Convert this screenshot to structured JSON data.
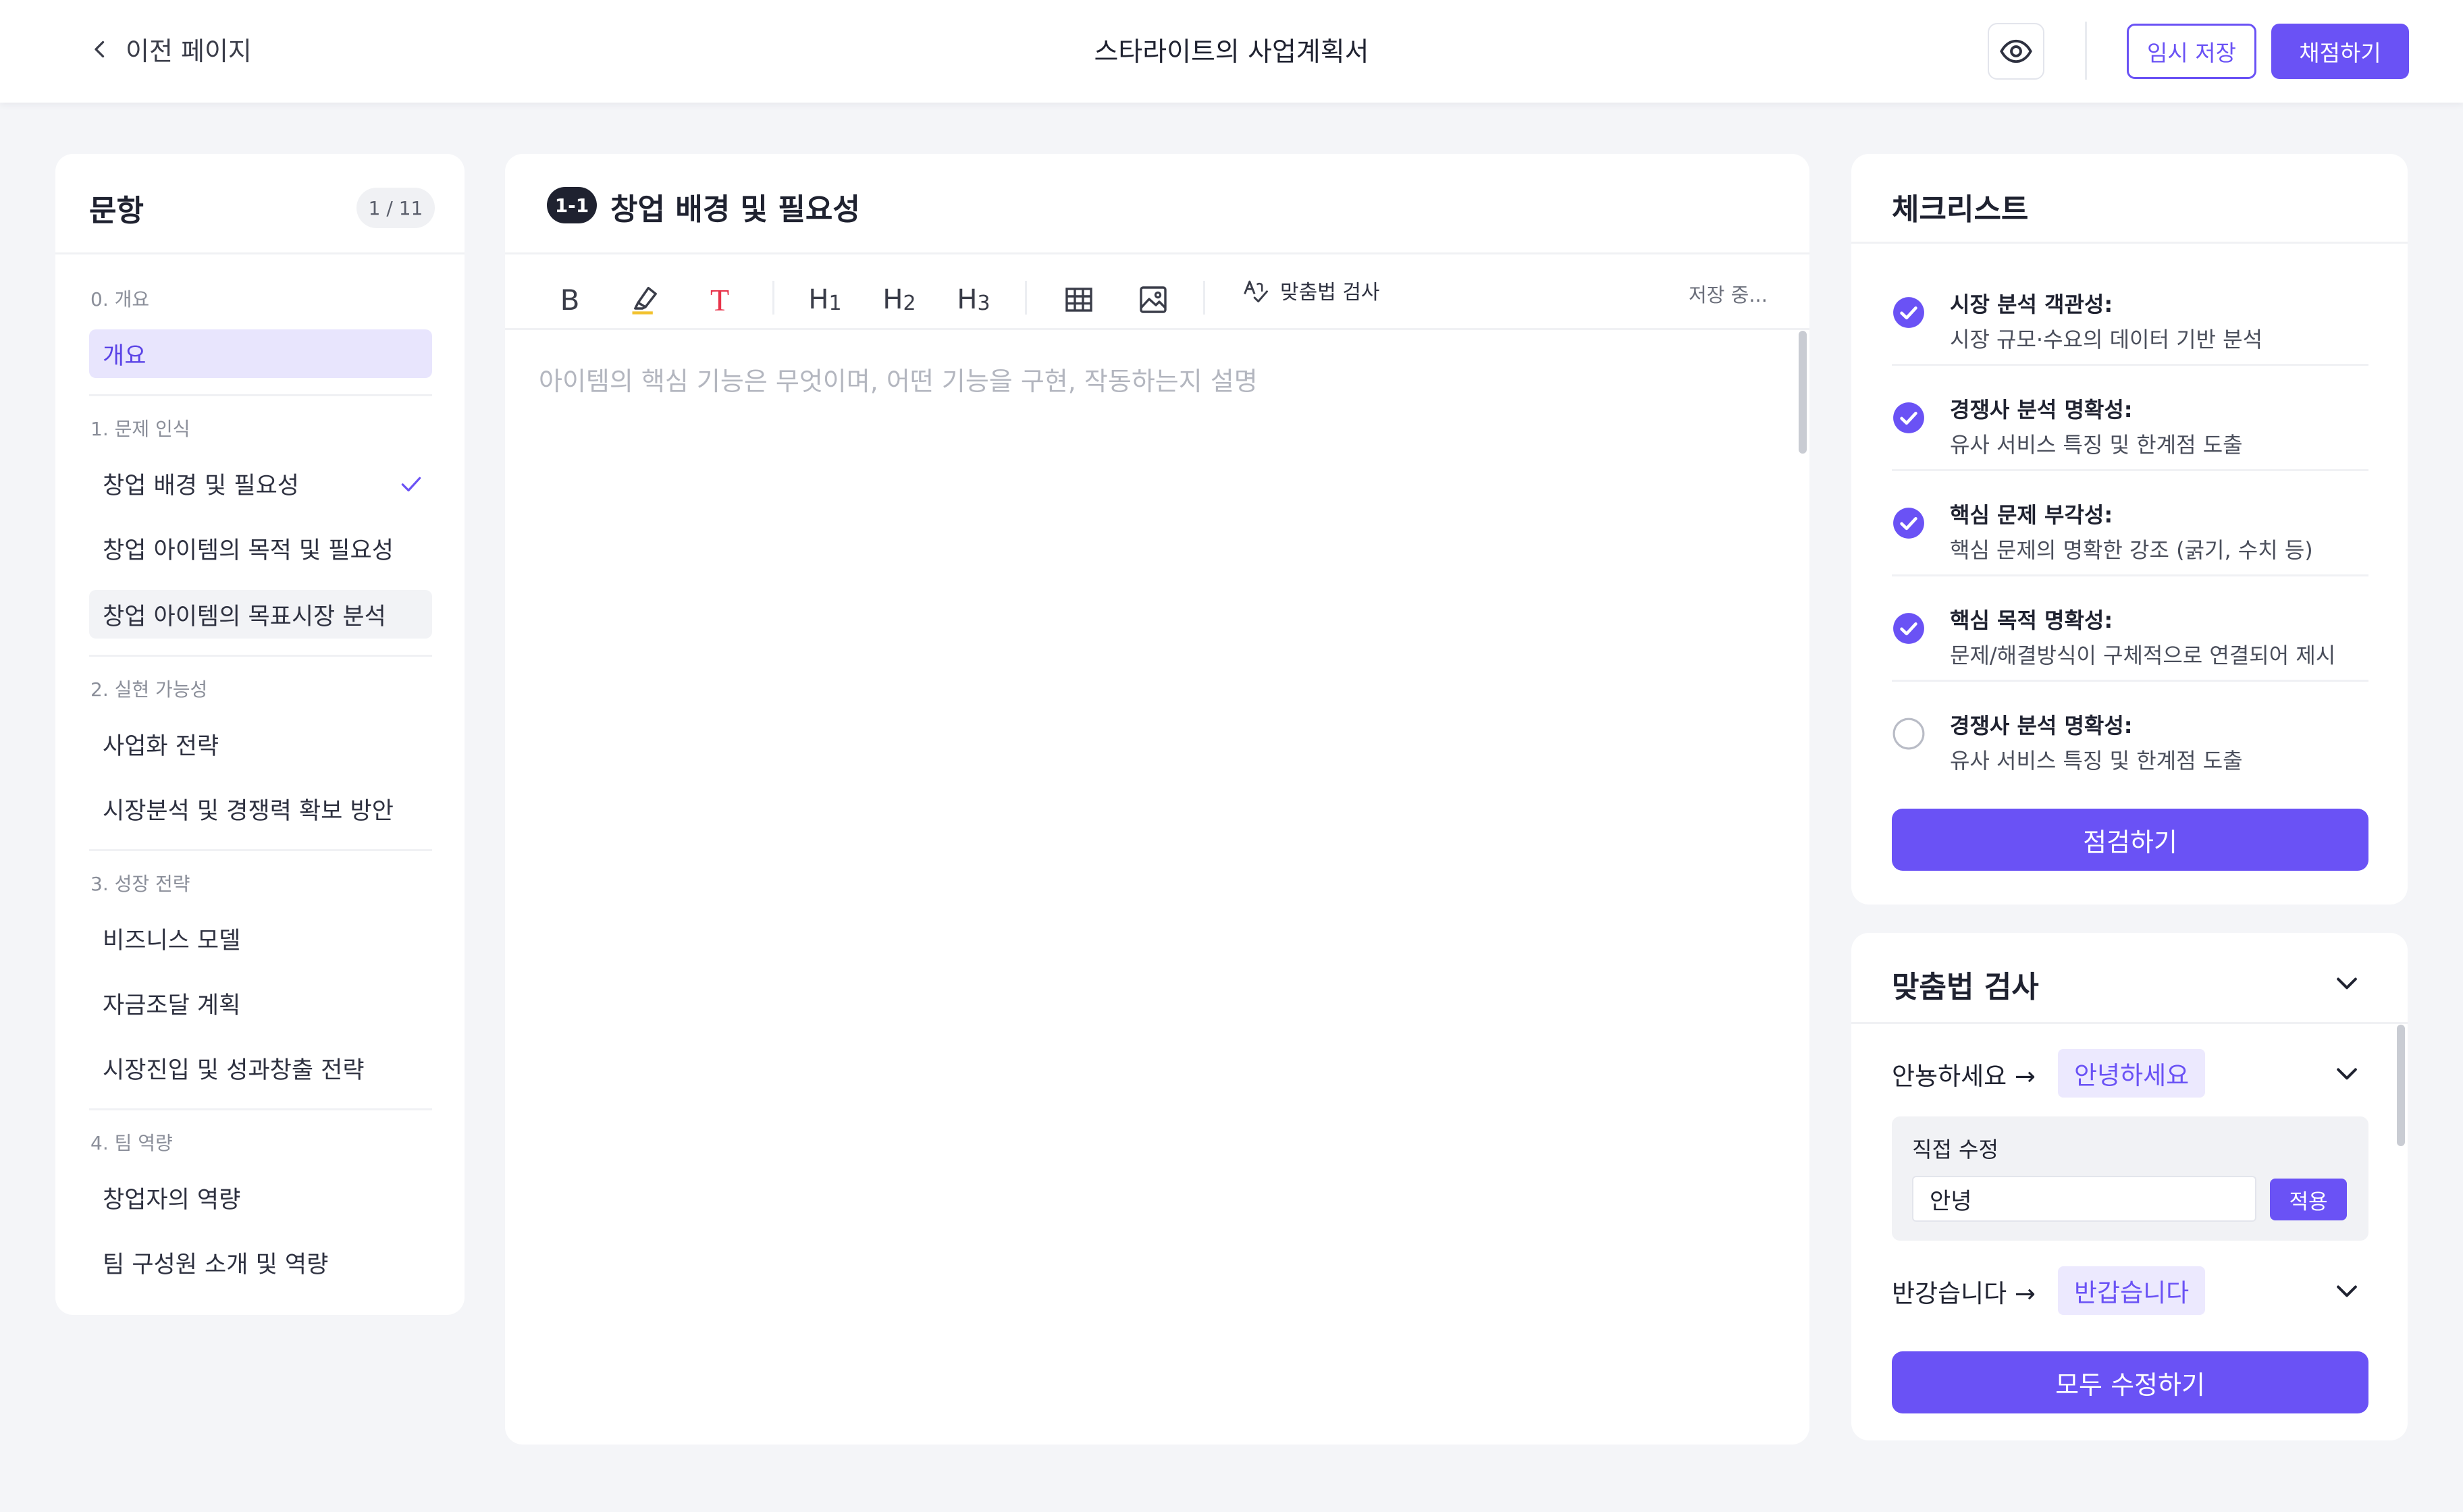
{
  "header": {
    "back_label": "이전 페이지",
    "doc_title": "스타라이트의 사업계획서",
    "temp_save_label": "임시 저장",
    "grade_label": "채점하기"
  },
  "questions": {
    "title": "문항",
    "count": "1 / 11",
    "sections": [
      {
        "label": "0. 개요",
        "items": [
          {
            "label": "개요"
          }
        ]
      },
      {
        "label": "1. 문제 인식",
        "items": [
          {
            "label": "창업 배경 및 필요성"
          },
          {
            "label": "창업 아이템의 목적 및 필요성"
          },
          {
            "label": "창업 아이템의 목표시장 분석"
          }
        ]
      },
      {
        "label": "2. 실현 가능성",
        "items": [
          {
            "label": "사업화 전략"
          },
          {
            "label": "시장분석 및 경쟁력 확보 방안"
          }
        ]
      },
      {
        "label": "3. 성장 전략",
        "items": [
          {
            "label": "비즈니스 모델"
          },
          {
            "label": "자금조달 계획"
          },
          {
            "label": "시장진입 및 성과창출 전략"
          }
        ]
      },
      {
        "label": "4. 팀 역량",
        "items": [
          {
            "label": "창업자의 역량"
          },
          {
            "label": "팀 구성원 소개 및 역량"
          }
        ]
      }
    ]
  },
  "editor": {
    "badge": "1-1",
    "title": "창업 배경 및 필요성",
    "toolbar": {
      "bold": "B",
      "text_color": "T",
      "h1": "H",
      "h1_sub": "1",
      "h2": "H",
      "h2_sub": "2",
      "h3": "H",
      "h3_sub": "3",
      "spell_label": "맞춤법 검사",
      "status": "저장 중..."
    },
    "placeholder": "아이템의 핵심 기능은 무엇이며, 어떤 기능을 구현, 작동하는지 설명"
  },
  "checklist": {
    "title": "체크리스트",
    "items": [
      {
        "title": "시장 분석 객관성:",
        "desc": "시장 규모·수요의 데이터 기반 분석",
        "checked": true
      },
      {
        "title": "경쟁사 분석 명확성:",
        "desc": "유사 서비스 특징 및 한계점 도출",
        "checked": true
      },
      {
        "title": "핵심 문제 부각성:",
        "desc": "핵심 문제의 명확한 강조 (굵기, 수치 등)",
        "checked": true
      },
      {
        "title": "핵심 목적 명확성:",
        "desc": "문제/해결방식이 구체적으로 연결되어 제시",
        "checked": true
      },
      {
        "title": "경쟁사 분석 명확성:",
        "desc": "유사 서비스 특징 및 한계점 도출",
        "checked": false
      }
    ],
    "button_label": "점검하기"
  },
  "spellcheck": {
    "title": "맞춤법 검사",
    "items": [
      {
        "original": "안뇽하세요 →",
        "suggestion": "안녕하세요"
      },
      {
        "original": "반강습니다 →",
        "suggestion": "반갑습니다"
      }
    ],
    "direct_edit_label": "직접 수정",
    "direct_edit_value": "안녕",
    "apply_label": "적용",
    "fix_all_label": "모두 수정하기"
  },
  "colors": {
    "accent": "#6a52f5",
    "accent_light": "#e8e5fd",
    "text_color_icon": "#e8334a"
  }
}
